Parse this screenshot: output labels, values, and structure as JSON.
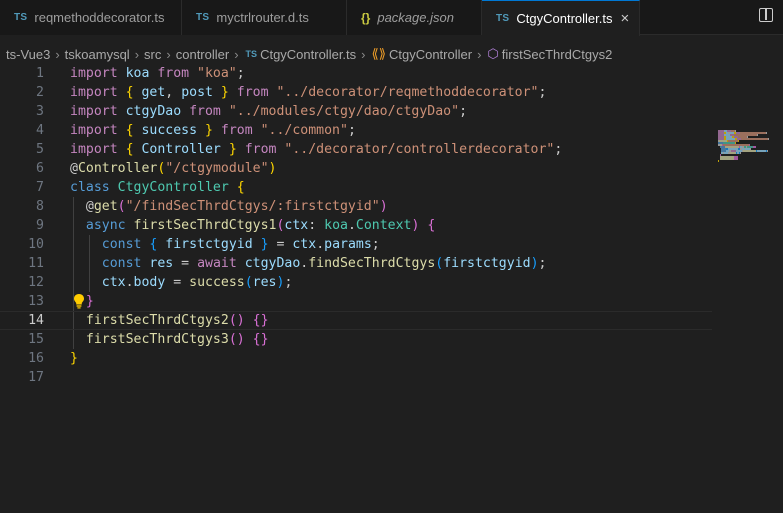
{
  "tabs": [
    {
      "label": "reqmethoddecorator.ts",
      "icon": "TS"
    },
    {
      "label": "myctrlrouter.d.ts",
      "icon": "TS"
    },
    {
      "label": "package.json",
      "icon": "{}"
    },
    {
      "label": "CtgyController.ts",
      "icon": "TS",
      "close": "×"
    }
  ],
  "breadcrumb": [
    "ts-Vue3",
    "tskoamysql",
    "src",
    "controller",
    "CtgyController.ts",
    "CtgyController",
    "firstSecThrdCtgys2"
  ],
  "breadcrumb_sep": "›",
  "editor": {
    "current_line": 14,
    "line_numbers": [
      "1",
      "2",
      "3",
      "4",
      "5",
      "6",
      "7",
      "8",
      "9",
      "10",
      "11",
      "12",
      "13",
      "14",
      "15",
      "16",
      "17"
    ],
    "lines": [
      [
        [
          "import ",
          "k"
        ],
        [
          "koa ",
          "v"
        ],
        [
          "from ",
          "k"
        ],
        [
          "\"koa\"",
          "s"
        ],
        [
          ";",
          "p"
        ]
      ],
      [
        [
          "import ",
          "k"
        ],
        [
          "{ ",
          "b1"
        ],
        [
          "get",
          "v"
        ],
        [
          ", ",
          "p"
        ],
        [
          "post ",
          "v"
        ],
        [
          "} ",
          "b1"
        ],
        [
          "from ",
          "k"
        ],
        [
          "\"../decorator/reqmethoddecorator\"",
          "s"
        ],
        [
          ";",
          "p"
        ]
      ],
      [
        [
          "import ",
          "k"
        ],
        [
          "ctgyDao ",
          "v"
        ],
        [
          "from ",
          "k"
        ],
        [
          "\"../modules/ctgy/dao/ctgyDao\"",
          "s"
        ],
        [
          ";",
          "p"
        ]
      ],
      [
        [
          "import ",
          "k"
        ],
        [
          "{ ",
          "b1"
        ],
        [
          "success ",
          "v"
        ],
        [
          "} ",
          "b1"
        ],
        [
          "from ",
          "k"
        ],
        [
          "\"../common\"",
          "s"
        ],
        [
          ";",
          "p"
        ]
      ],
      [
        [
          "import ",
          "k"
        ],
        [
          "{ ",
          "b1"
        ],
        [
          "Controller ",
          "v"
        ],
        [
          "} ",
          "b1"
        ],
        [
          "from ",
          "k"
        ],
        [
          "\"../decorator/controllerdecorator\"",
          "s"
        ],
        [
          ";",
          "p"
        ]
      ],
      [
        [
          "@",
          "p"
        ],
        [
          "Controller",
          "f"
        ],
        [
          "(",
          "b1"
        ],
        [
          "\"/ctgymodule\"",
          "s"
        ],
        [
          ")",
          "b1"
        ]
      ],
      [
        [
          "class ",
          "kb"
        ],
        [
          "CtgyController ",
          "c"
        ],
        [
          "{",
          "b1"
        ]
      ],
      [
        [
          "  @",
          "p"
        ],
        [
          "get",
          "f"
        ],
        [
          "(",
          "b2"
        ],
        [
          "\"/findSecThrdCtgys/:firstctgyid\"",
          "s"
        ],
        [
          ")",
          "b2"
        ]
      ],
      [
        [
          "  ",
          "p"
        ],
        [
          "async ",
          "kb"
        ],
        [
          "firstSecThrdCtgys1",
          "f"
        ],
        [
          "(",
          "b2"
        ],
        [
          "ctx",
          "v"
        ],
        [
          ": ",
          "p"
        ],
        [
          "koa",
          "c"
        ],
        [
          ".",
          "p"
        ],
        [
          "Context",
          "c"
        ],
        [
          ") ",
          "b2"
        ],
        [
          "{",
          "b2"
        ]
      ],
      [
        [
          "    ",
          "p"
        ],
        [
          "const ",
          "kb"
        ],
        [
          "{ ",
          "b3"
        ],
        [
          "firstctgyid ",
          "v"
        ],
        [
          "} ",
          "b3"
        ],
        [
          "= ",
          "p"
        ],
        [
          "ctx",
          "v"
        ],
        [
          ".",
          "p"
        ],
        [
          "params",
          "v"
        ],
        [
          ";",
          "p"
        ]
      ],
      [
        [
          "    ",
          "p"
        ],
        [
          "const ",
          "kb"
        ],
        [
          "res ",
          "v"
        ],
        [
          "= ",
          "p"
        ],
        [
          "await ",
          "k"
        ],
        [
          "ctgyDao",
          "v"
        ],
        [
          ".",
          "p"
        ],
        [
          "findSecThrdCtgys",
          "f"
        ],
        [
          "(",
          "b3"
        ],
        [
          "firstctgyid",
          "v"
        ],
        [
          ")",
          "b3"
        ],
        [
          ";",
          "p"
        ]
      ],
      [
        [
          "    ",
          "p"
        ],
        [
          "ctx",
          "v"
        ],
        [
          ".",
          "p"
        ],
        [
          "body ",
          "v"
        ],
        [
          "= ",
          "p"
        ],
        [
          "success",
          "f"
        ],
        [
          "(",
          "b3"
        ],
        [
          "res",
          "v"
        ],
        [
          ")",
          "b3"
        ],
        [
          ";",
          "p"
        ]
      ],
      [
        [
          "  ",
          "p"
        ],
        [
          "}",
          "b2"
        ]
      ],
      [
        [
          "  ",
          "p"
        ],
        [
          "firstSecThrdCtgys2",
          "f"
        ],
        [
          "() ",
          "b2"
        ],
        [
          "{}",
          "b2"
        ]
      ],
      [
        [
          "  ",
          "p"
        ],
        [
          "firstSecThrdCtgys3",
          "f"
        ],
        [
          "() ",
          "b2"
        ],
        [
          "{}",
          "b2"
        ]
      ],
      [
        [
          "}",
          "b1"
        ]
      ],
      []
    ]
  },
  "icons": {
    "lightbulb": "lightbulb-icon",
    "split_editor": "split-editor-icon"
  },
  "colors": {
    "accent": "#0078d4",
    "background": "#1f1f1f",
    "keyword": "#c586c0",
    "string": "#ce9178"
  }
}
